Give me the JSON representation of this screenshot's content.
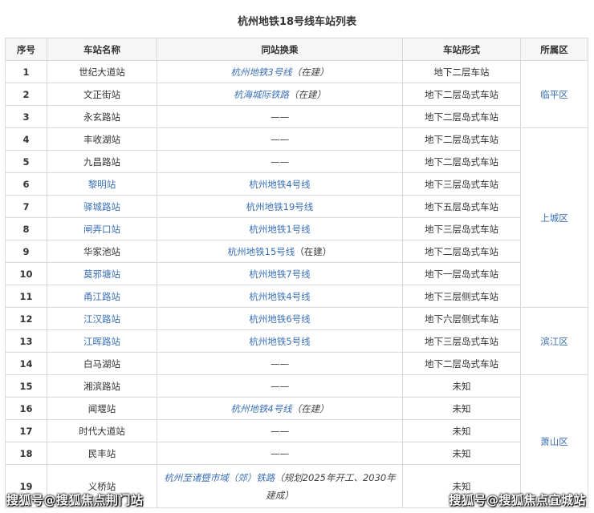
{
  "title": "杭州地铁18号线车站列表",
  "headers": [
    "序号",
    "车站名称",
    "同站换乘",
    "车站形式",
    "所属区"
  ],
  "rows": [
    {
      "seq": "1",
      "name": "世纪大道站",
      "transfer_link": "杭州地铁3号线",
      "transfer_note": "（在建）",
      "form": "地下二层车站"
    },
    {
      "seq": "2",
      "name": "文正街站",
      "transfer_link": "杭海城际铁路",
      "transfer_note": "（在建）",
      "form": "地下二层岛式车站"
    },
    {
      "seq": "3",
      "name": "永玄路站",
      "transfer_text": "——",
      "form": "地下二层岛式车站"
    },
    {
      "seq": "4",
      "name": "丰收湖站",
      "transfer_text": "——",
      "form": "地下二层岛式车站"
    },
    {
      "seq": "5",
      "name": "九昌路站",
      "transfer_text": "——",
      "form": "地下二层岛式车站"
    },
    {
      "seq": "6",
      "name": "黎明站",
      "transfer_text": "杭州地铁4号线",
      "form": "地下三层岛式车站"
    },
    {
      "seq": "7",
      "name": "驿城路站",
      "transfer_text": "杭州地铁19号线",
      "form": "地下五层岛式车站"
    },
    {
      "seq": "8",
      "name": "闸弄口站",
      "transfer_text": "杭州地铁1号线",
      "form": "地下三层岛式车站"
    },
    {
      "seq": "9",
      "name": "华家池站",
      "transfer_text": "杭州地铁15号线",
      "transfer_plain_note": "（在建）",
      "form": "地下二层岛式车站"
    },
    {
      "seq": "10",
      "name": "莫邪塘站",
      "transfer_text": "杭州地铁7号线",
      "form": "地下一层岛式车站"
    },
    {
      "seq": "11",
      "name": "甬江路站",
      "transfer_text": "杭州地铁4号线",
      "form": "地下三层侧式车站"
    },
    {
      "seq": "12",
      "name": "江汉路站",
      "transfer_text": "杭州地铁6号线",
      "form": "地下六层侧式车站"
    },
    {
      "seq": "13",
      "name": "江晖路站",
      "transfer_text": "杭州地铁5号线",
      "form": "地下三层岛式车站"
    },
    {
      "seq": "14",
      "name": "白马湖站",
      "transfer_text": "——",
      "form": "地下二层岛式车站"
    },
    {
      "seq": "15",
      "name": "湘滨路站",
      "transfer_text": "——",
      "form": "未知"
    },
    {
      "seq": "16",
      "name": "闻堰站",
      "transfer_link": "杭州地铁4号线",
      "transfer_note": "（在建）",
      "form": "未知"
    },
    {
      "seq": "17",
      "name": "时代大道站",
      "transfer_text": "——",
      "form": "未知"
    },
    {
      "seq": "18",
      "name": "民丰站",
      "transfer_text": "——",
      "form": "未知"
    },
    {
      "seq": "19",
      "name": "义桥站",
      "transfer_link": "杭州至诸暨市域（郊）铁路",
      "transfer_note": "（规划2025年开工、2030年建成）",
      "form": "未知"
    }
  ],
  "districts": [
    "临平区",
    "上城区",
    "滨江区",
    "萧山区"
  ],
  "watermark_left": "搜狐号@搜狐焦点荆门站",
  "watermark_right": "搜狐号@搜狐焦点宜城站",
  "colors": {
    "link": "#3a6fb5",
    "header_bg": "#f6f6f6",
    "border": "#d9d9d9"
  }
}
